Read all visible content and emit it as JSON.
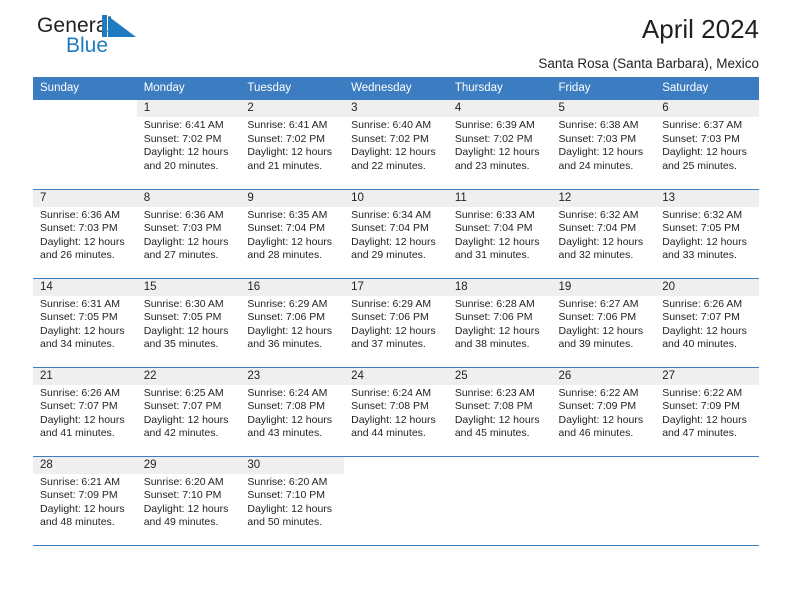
{
  "brand": {
    "name_part1": "General",
    "name_part2": "Blue",
    "logo_color": "#1f7bc1",
    "text_color": "#231f20"
  },
  "header": {
    "title": "April 2024",
    "subtitle": "Santa Rosa (Santa Barbara), Mexico"
  },
  "theme": {
    "header_blue": "#3b7dc0",
    "daynum_band": "#efefef",
    "text": "#231f20",
    "page_bg": "#ffffff"
  },
  "weekday_headers": [
    "Sunday",
    "Monday",
    "Tuesday",
    "Wednesday",
    "Thursday",
    "Friday",
    "Saturday"
  ],
  "weeks": [
    [
      {
        "day": "",
        "blank": true,
        "lines": []
      },
      {
        "day": "1",
        "lines": [
          "Sunrise: 6:41 AM",
          "Sunset: 7:02 PM",
          "Daylight: 12 hours",
          "and 20 minutes."
        ]
      },
      {
        "day": "2",
        "lines": [
          "Sunrise: 6:41 AM",
          "Sunset: 7:02 PM",
          "Daylight: 12 hours",
          "and 21 minutes."
        ]
      },
      {
        "day": "3",
        "lines": [
          "Sunrise: 6:40 AM",
          "Sunset: 7:02 PM",
          "Daylight: 12 hours",
          "and 22 minutes."
        ]
      },
      {
        "day": "4",
        "lines": [
          "Sunrise: 6:39 AM",
          "Sunset: 7:02 PM",
          "Daylight: 12 hours",
          "and 23 minutes."
        ]
      },
      {
        "day": "5",
        "lines": [
          "Sunrise: 6:38 AM",
          "Sunset: 7:03 PM",
          "Daylight: 12 hours",
          "and 24 minutes."
        ]
      },
      {
        "day": "6",
        "lines": [
          "Sunrise: 6:37 AM",
          "Sunset: 7:03 PM",
          "Daylight: 12 hours",
          "and 25 minutes."
        ]
      }
    ],
    [
      {
        "day": "7",
        "lines": [
          "Sunrise: 6:36 AM",
          "Sunset: 7:03 PM",
          "Daylight: 12 hours",
          "and 26 minutes."
        ]
      },
      {
        "day": "8",
        "lines": [
          "Sunrise: 6:36 AM",
          "Sunset: 7:03 PM",
          "Daylight: 12 hours",
          "and 27 minutes."
        ]
      },
      {
        "day": "9",
        "lines": [
          "Sunrise: 6:35 AM",
          "Sunset: 7:04 PM",
          "Daylight: 12 hours",
          "and 28 minutes."
        ]
      },
      {
        "day": "10",
        "lines": [
          "Sunrise: 6:34 AM",
          "Sunset: 7:04 PM",
          "Daylight: 12 hours",
          "and 29 minutes."
        ]
      },
      {
        "day": "11",
        "lines": [
          "Sunrise: 6:33 AM",
          "Sunset: 7:04 PM",
          "Daylight: 12 hours",
          "and 31 minutes."
        ]
      },
      {
        "day": "12",
        "lines": [
          "Sunrise: 6:32 AM",
          "Sunset: 7:04 PM",
          "Daylight: 12 hours",
          "and 32 minutes."
        ]
      },
      {
        "day": "13",
        "lines": [
          "Sunrise: 6:32 AM",
          "Sunset: 7:05 PM",
          "Daylight: 12 hours",
          "and 33 minutes."
        ]
      }
    ],
    [
      {
        "day": "14",
        "lines": [
          "Sunrise: 6:31 AM",
          "Sunset: 7:05 PM",
          "Daylight: 12 hours",
          "and 34 minutes."
        ]
      },
      {
        "day": "15",
        "lines": [
          "Sunrise: 6:30 AM",
          "Sunset: 7:05 PM",
          "Daylight: 12 hours",
          "and 35 minutes."
        ]
      },
      {
        "day": "16",
        "lines": [
          "Sunrise: 6:29 AM",
          "Sunset: 7:06 PM",
          "Daylight: 12 hours",
          "and 36 minutes."
        ]
      },
      {
        "day": "17",
        "lines": [
          "Sunrise: 6:29 AM",
          "Sunset: 7:06 PM",
          "Daylight: 12 hours",
          "and 37 minutes."
        ]
      },
      {
        "day": "18",
        "lines": [
          "Sunrise: 6:28 AM",
          "Sunset: 7:06 PM",
          "Daylight: 12 hours",
          "and 38 minutes."
        ]
      },
      {
        "day": "19",
        "lines": [
          "Sunrise: 6:27 AM",
          "Sunset: 7:06 PM",
          "Daylight: 12 hours",
          "and 39 minutes."
        ]
      },
      {
        "day": "20",
        "lines": [
          "Sunrise: 6:26 AM",
          "Sunset: 7:07 PM",
          "Daylight: 12 hours",
          "and 40 minutes."
        ]
      }
    ],
    [
      {
        "day": "21",
        "lines": [
          "Sunrise: 6:26 AM",
          "Sunset: 7:07 PM",
          "Daylight: 12 hours",
          "and 41 minutes."
        ]
      },
      {
        "day": "22",
        "lines": [
          "Sunrise: 6:25 AM",
          "Sunset: 7:07 PM",
          "Daylight: 12 hours",
          "and 42 minutes."
        ]
      },
      {
        "day": "23",
        "lines": [
          "Sunrise: 6:24 AM",
          "Sunset: 7:08 PM",
          "Daylight: 12 hours",
          "and 43 minutes."
        ]
      },
      {
        "day": "24",
        "lines": [
          "Sunrise: 6:24 AM",
          "Sunset: 7:08 PM",
          "Daylight: 12 hours",
          "and 44 minutes."
        ]
      },
      {
        "day": "25",
        "lines": [
          "Sunrise: 6:23 AM",
          "Sunset: 7:08 PM",
          "Daylight: 12 hours",
          "and 45 minutes."
        ]
      },
      {
        "day": "26",
        "lines": [
          "Sunrise: 6:22 AM",
          "Sunset: 7:09 PM",
          "Daylight: 12 hours",
          "and 46 minutes."
        ]
      },
      {
        "day": "27",
        "lines": [
          "Sunrise: 6:22 AM",
          "Sunset: 7:09 PM",
          "Daylight: 12 hours",
          "and 47 minutes."
        ]
      }
    ],
    [
      {
        "day": "28",
        "lines": [
          "Sunrise: 6:21 AM",
          "Sunset: 7:09 PM",
          "Daylight: 12 hours",
          "and 48 minutes."
        ]
      },
      {
        "day": "29",
        "lines": [
          "Sunrise: 6:20 AM",
          "Sunset: 7:10 PM",
          "Daylight: 12 hours",
          "and 49 minutes."
        ]
      },
      {
        "day": "30",
        "lines": [
          "Sunrise: 6:20 AM",
          "Sunset: 7:10 PM",
          "Daylight: 12 hours",
          "and 50 minutes."
        ]
      },
      {
        "day": "",
        "blank": true,
        "lines": []
      },
      {
        "day": "",
        "blank": true,
        "lines": []
      },
      {
        "day": "",
        "blank": true,
        "lines": []
      },
      {
        "day": "",
        "blank": true,
        "lines": []
      }
    ]
  ]
}
